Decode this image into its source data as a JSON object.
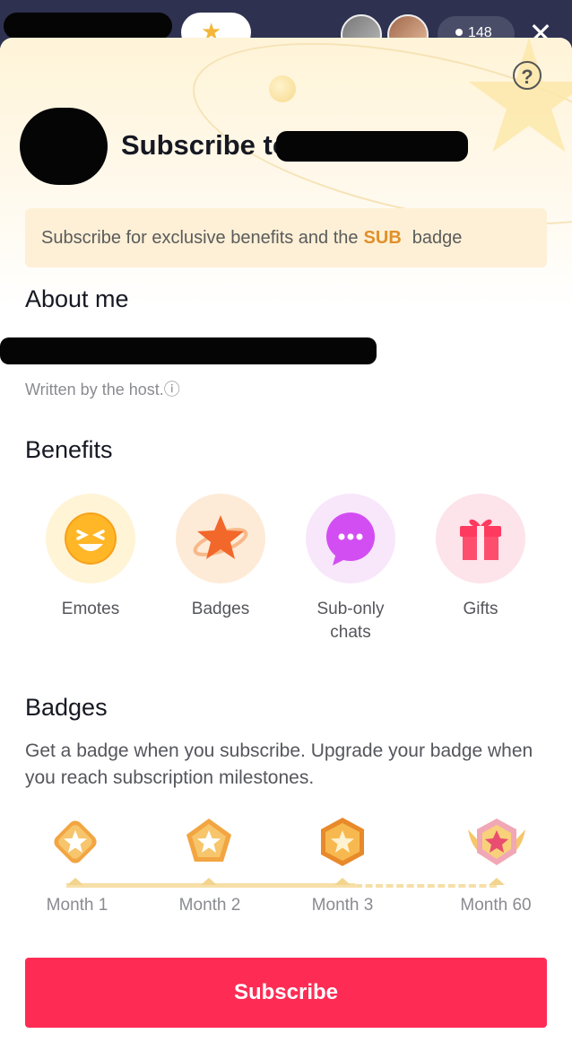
{
  "live": {
    "viewer_count": "148"
  },
  "header": {
    "title_prefix": "Subscribe to",
    "banner_text": "Subscribe for exclusive benefits and the",
    "banner_badge": "SUB",
    "banner_suffix": "badge"
  },
  "about": {
    "heading": "About me",
    "written_by": "Written by the host.",
    "info_icon": "ⓘ"
  },
  "benefits": {
    "heading": "Benefits",
    "items": [
      {
        "label": "Emotes",
        "icon": "emote-icon"
      },
      {
        "label": "Badges",
        "icon": "badge-star-icon"
      },
      {
        "label": "Sub-only chats",
        "icon": "chat-bubble-icon"
      },
      {
        "label": "Gifts",
        "icon": "gift-icon"
      }
    ]
  },
  "badges": {
    "heading": "Badges",
    "description": "Get a badge when you subscribe. Upgrade your badge when you reach subscription milestones.",
    "milestones": [
      {
        "label": "Month 1"
      },
      {
        "label": "Month 2"
      },
      {
        "label": "Month 3"
      },
      {
        "label": "Month 60"
      }
    ]
  },
  "cta": {
    "subscribe_label": "Subscribe"
  },
  "colors": {
    "accent": "#fe2c55",
    "sub_badge": "#e0902a",
    "banner_bg": "#fdf0d6"
  }
}
